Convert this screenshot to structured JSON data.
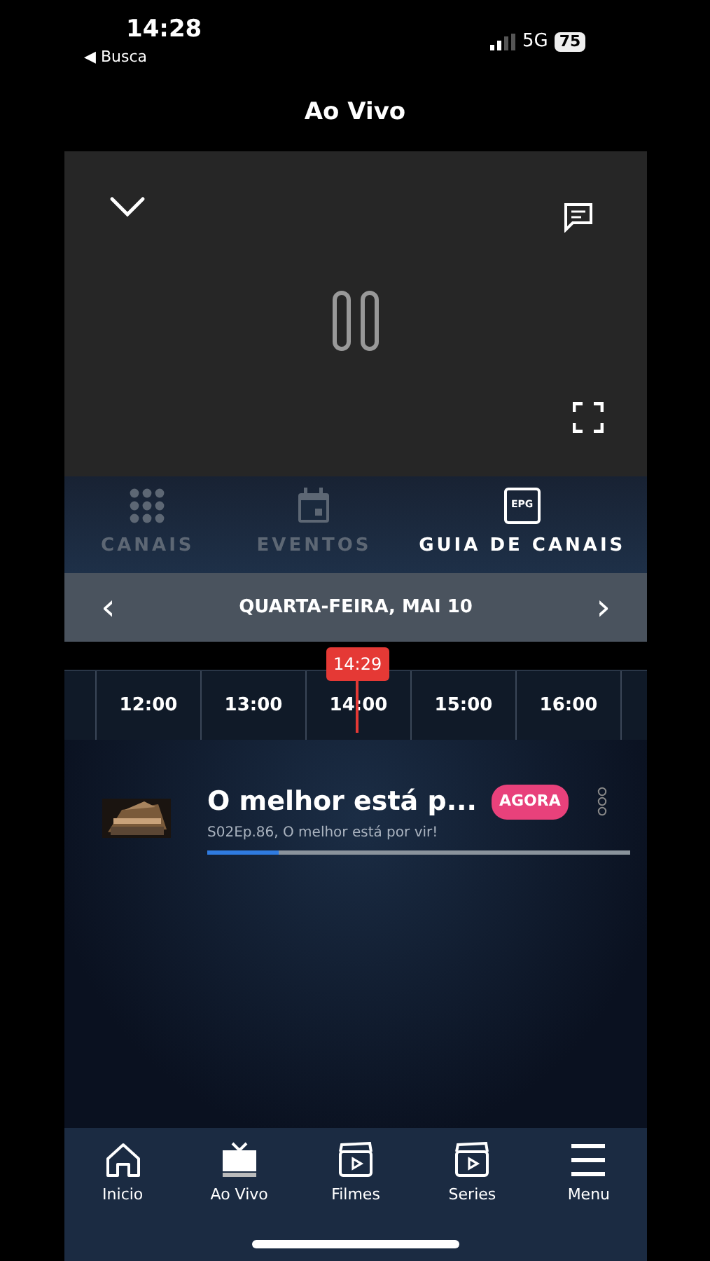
{
  "status_bar": {
    "time": "14:28",
    "back_label": "◀ Busca",
    "network": "5G",
    "battery": "75"
  },
  "header": {
    "title": "Ao Vivo"
  },
  "tabs": [
    {
      "label": "CANAIS",
      "kind": "grid",
      "selected": false
    },
    {
      "label": "EVENTOS",
      "kind": "calendar",
      "selected": false
    },
    {
      "label": "GUIA DE CANAIS",
      "kind": "epg",
      "selected": true
    }
  ],
  "epg_icon_label": "EPG",
  "date_bar": {
    "prev": "‹",
    "label": "QUARTA-FEIRA, MAI 10",
    "next": "›"
  },
  "timeline": {
    "now": "14:29",
    "slots": [
      {
        "time": "12:00"
      },
      {
        "time": "13:00"
      },
      {
        "time": "14:00"
      },
      {
        "time": "15:00"
      },
      {
        "time": "16:00"
      }
    ]
  },
  "program": {
    "kind": "picture",
    "title": "O melhor está p...",
    "badge": "AGORA",
    "subtitle": "S02Ep.86, O melhor está por vir!",
    "level": 0.17
  },
  "bottom_nav": [
    {
      "label": "Inicio",
      "kind": "home"
    },
    {
      "label": "Ao Vivo",
      "kind": "tv"
    },
    {
      "label": "Filmes",
      "kind": "clapper"
    },
    {
      "label": "Series",
      "kind": "clapper"
    },
    {
      "label": "Menu",
      "kind": "menu"
    }
  ]
}
